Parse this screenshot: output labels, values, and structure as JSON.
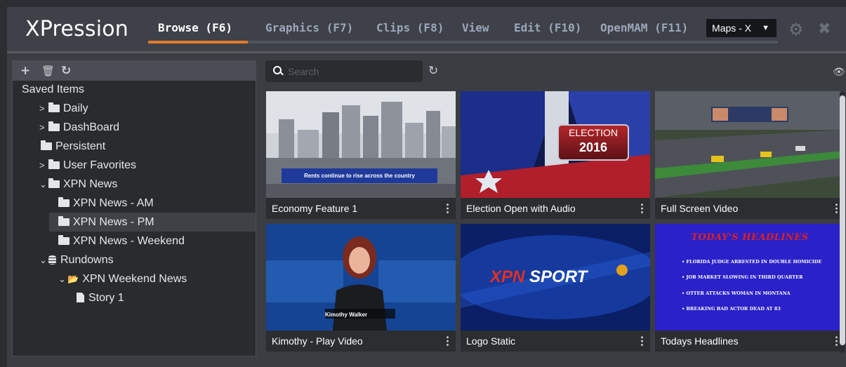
{
  "app": {
    "title": "XPression"
  },
  "nav": {
    "tabs": [
      {
        "label": "Browse (F6)",
        "active": true
      },
      {
        "label": "Graphics (F7)",
        "active": false
      },
      {
        "label": "Clips (F8)",
        "active": false
      },
      {
        "label": "View",
        "active": false
      },
      {
        "label": "Edit (F10)",
        "active": false
      },
      {
        "label": "OpenMAM (F11)",
        "active": false
      }
    ],
    "maps_select": "Maps - X",
    "icons": [
      "gear-icon",
      "close-icon"
    ]
  },
  "tree": {
    "toolbar_icons": [
      "plus-icon",
      "trash-icon",
      "refresh-icon"
    ],
    "items": [
      {
        "label": "Saved Items",
        "icon": "none",
        "expander": "none"
      },
      {
        "label": "Daily",
        "icon": "folder-icon",
        "expander": "collapsed"
      },
      {
        "label": "DashBoard",
        "icon": "folder-icon",
        "expander": "collapsed"
      },
      {
        "label": "Persistent",
        "icon": "folder-icon",
        "expander": "none"
      },
      {
        "label": "User Favorites",
        "icon": "folder-icon",
        "expander": "collapsed"
      },
      {
        "label": "XPN News",
        "icon": "folder-icon",
        "expander": "expanded"
      },
      {
        "label": "XPN News - AM",
        "icon": "folder-icon",
        "expander": "none"
      },
      {
        "label": "XPN News - PM",
        "icon": "folder-icon",
        "expander": "none",
        "selected": true
      },
      {
        "label": "XPN News - Weekend",
        "icon": "folder-icon",
        "expander": "none"
      },
      {
        "label": "Rundowns",
        "icon": "database-icon",
        "expander": "expanded"
      },
      {
        "label": "XPN Weekend News",
        "icon": "folder-open-icon",
        "expander": "expanded"
      },
      {
        "label": "Story 1",
        "icon": "file-icon",
        "expander": "none"
      }
    ]
  },
  "search": {
    "placeholder": "Search",
    "value": ""
  },
  "cards": [
    {
      "title": "Economy Feature 1",
      "overlay": "Rents continue to rise across the country"
    },
    {
      "title": "Election Open with Audio",
      "overlay_1": "ELECTION",
      "overlay_2": "2016"
    },
    {
      "title": "Full Screen Video"
    },
    {
      "title": "Kimothy - Play Video",
      "overlay": "Kimothy Walker"
    },
    {
      "title": "Logo Static",
      "overlay_1": "XPN",
      "overlay_2": "SPORT"
    },
    {
      "title": "Todays Headlines",
      "overlay_title": "TODAY'S HEADLINES",
      "headlines": [
        "• FLORIDA JUDGE ARRESTED IN DOUBLE HOMICIDE",
        "• JOB MARKET SLOWING IN THIRD QUARTER",
        "• OTTER ATTACKS WOMAN IN MONTANA",
        "• BREAKING BAD ACTOR DEAD AT 83"
      ]
    }
  ],
  "colors": {
    "accent": "#e27a2b",
    "background": "#3a3d42",
    "panel": "#292b2e"
  }
}
